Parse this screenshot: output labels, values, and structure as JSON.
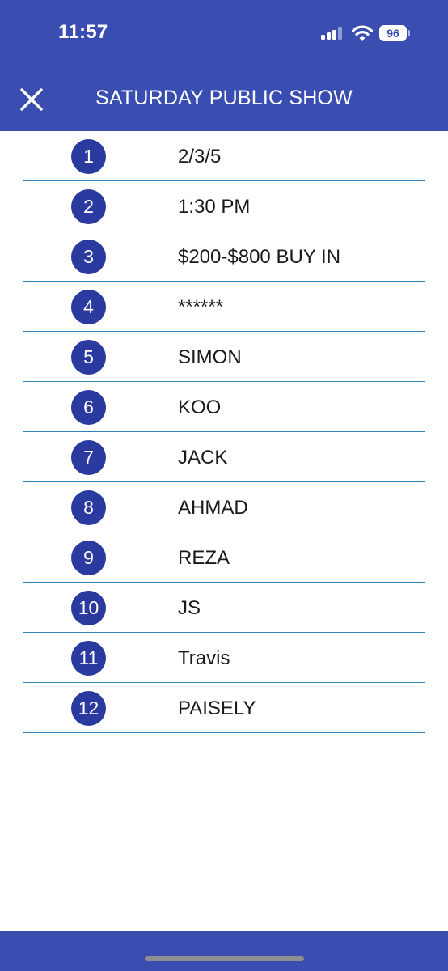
{
  "status_bar": {
    "time": "11:57",
    "battery_level": "96",
    "signal_bars_active": 3,
    "signal_bars_total": 4
  },
  "header": {
    "close_icon": "close-icon",
    "title": "SATURDAY PUBLIC SHOW"
  },
  "items": [
    {
      "number": "1",
      "text": "2/3/5"
    },
    {
      "number": "2",
      "text": "1:30 PM"
    },
    {
      "number": "3",
      "text": "$200-$800 BUY IN"
    },
    {
      "number": "4",
      "text": "******"
    },
    {
      "number": "5",
      "text": "SIMON"
    },
    {
      "number": "6",
      "text": "KOO"
    },
    {
      "number": "7",
      "text": "JACK"
    },
    {
      "number": "8",
      "text": "AHMAD"
    },
    {
      "number": "9",
      "text": "REZA"
    },
    {
      "number": "10",
      "text": "JS"
    },
    {
      "number": "11",
      "text": "Travis"
    },
    {
      "number": "12",
      "text": "PAISELY"
    }
  ],
  "colors": {
    "header_bg": "#3a4db1",
    "badge_bg": "#2a3a9e",
    "divider": "#2e80b7",
    "text": "#1a1a1a"
  }
}
